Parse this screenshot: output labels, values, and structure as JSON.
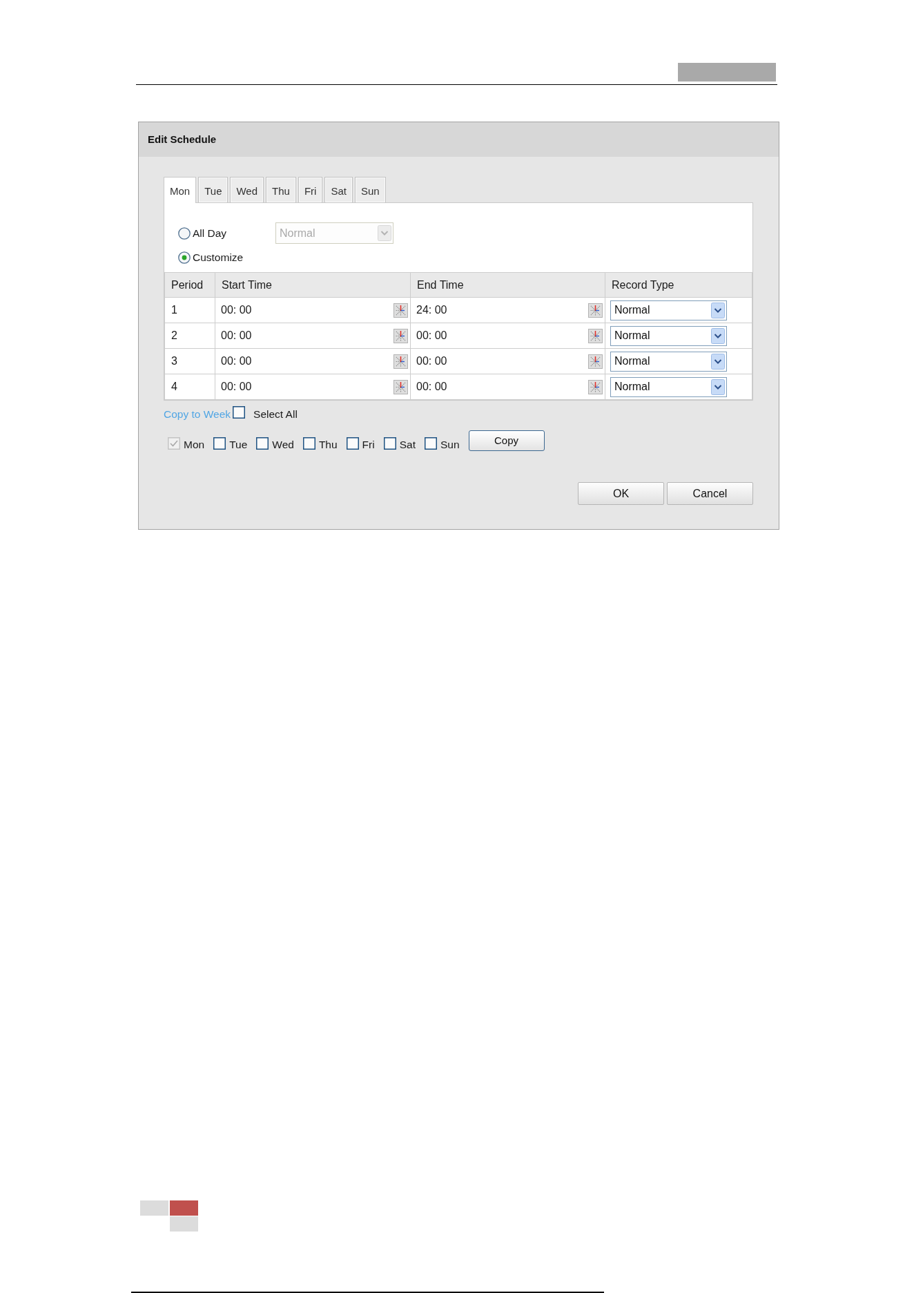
{
  "dialog": {
    "title": "Edit Schedule",
    "tabs": [
      {
        "label": "Mon",
        "selected": true
      },
      {
        "label": "Tue",
        "selected": false
      },
      {
        "label": "Wed",
        "selected": false
      },
      {
        "label": "Thu",
        "selected": false
      },
      {
        "label": "Fri",
        "selected": false
      },
      {
        "label": "Sat",
        "selected": false
      },
      {
        "label": "Sun",
        "selected": false
      }
    ],
    "schedule_modes": [
      {
        "label": "All Day",
        "selected": false,
        "record_type": {
          "value": "Normal",
          "disabled": true
        }
      },
      {
        "label": "Customize",
        "selected": true
      }
    ],
    "table": {
      "columns": [
        "Period",
        "Start Time",
        "End Time",
        "Record Type"
      ],
      "rows": [
        {
          "period": "1",
          "start_time": "00: 00",
          "end_time": "24: 00",
          "record_type": "Normal"
        },
        {
          "period": "2",
          "start_time": "00: 00",
          "end_time": "00: 00",
          "record_type": "Normal"
        },
        {
          "period": "3",
          "start_time": "00: 00",
          "end_time": "00: 00",
          "record_type": "Normal"
        },
        {
          "period": "4",
          "start_time": "00: 00",
          "end_time": "00: 00",
          "record_type": "Normal"
        }
      ]
    },
    "copy_to_week": {
      "link": "Copy to Week",
      "select_all": {
        "label": "Select All",
        "checked": false
      },
      "days": [
        {
          "label": "Mon",
          "checked": true,
          "disabled": true
        },
        {
          "label": "Tue",
          "checked": false,
          "disabled": false
        },
        {
          "label": "Wed",
          "checked": false,
          "disabled": false
        },
        {
          "label": "Thu",
          "checked": false,
          "disabled": false
        },
        {
          "label": "Fri",
          "checked": false,
          "disabled": false
        },
        {
          "label": "Sat",
          "checked": false,
          "disabled": false
        },
        {
          "label": "Sun",
          "checked": false,
          "disabled": false
        }
      ],
      "button": "Copy"
    },
    "buttons": [
      "OK",
      "Cancel"
    ]
  }
}
